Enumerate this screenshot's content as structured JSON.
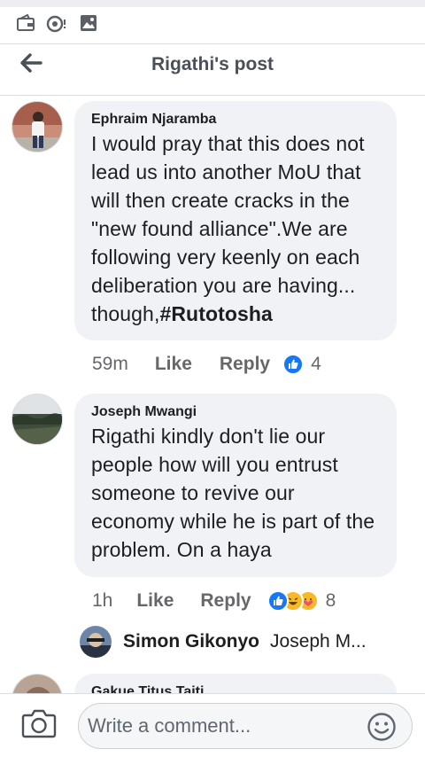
{
  "status_icons": [
    "wallet-icon",
    "messenger-icon",
    "gallery-icon"
  ],
  "header": {
    "title": "Rigathi's post",
    "back_icon": "back-arrow-icon"
  },
  "comments": [
    {
      "author": "Ephraim Njaramba",
      "text": "I would pray that this does not lead us into another  MoU that will then create cracks in the \"new found alliance\".We are following very keenly on each deliberation you are having... though,",
      "hashtag": "#Rutotosha",
      "time": "59m",
      "like_label": "Like",
      "reply_label": "Reply",
      "reactions": [
        "like"
      ],
      "reaction_count": "4"
    },
    {
      "author": "Joseph Mwangi",
      "text": "Rigathi kindly don't lie our people how will you entrust someone to revive our economy while he is part of  the problem. On a haya",
      "time": "1h",
      "like_label": "Like",
      "reply_label": "Reply",
      "reactions": [
        "like",
        "haha",
        "care"
      ],
      "reaction_count": "8",
      "reply": {
        "author": "Simon Gikonyo",
        "snippet": "Joseph M..."
      }
    },
    {
      "author": "Gakue Titus Taiti"
    }
  ],
  "compose": {
    "placeholder": "Write a comment...",
    "camera_icon": "camera-icon",
    "emoji_icon": "emoji-icon"
  },
  "colors": {
    "like_blue": "#1877f2",
    "haha_yellow": "#f7b928",
    "text_gray": "#65676b",
    "bubble_bg": "#f0f2f5"
  }
}
